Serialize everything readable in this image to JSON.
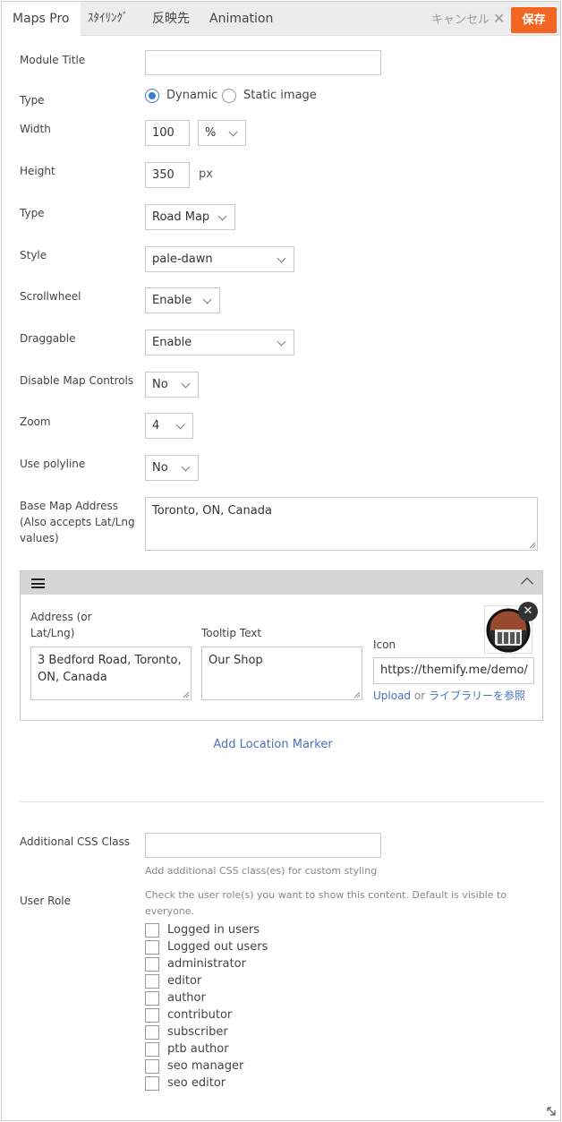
{
  "tabs": {
    "maps_pro": "Maps Pro",
    "styling": "ｽﾀｲﾘﾝｸﾞ",
    "visibility": "反映先",
    "animation": "Animation"
  },
  "header": {
    "cancel": "キャンセル",
    "save": "保存"
  },
  "fields": {
    "module_title": {
      "label": "Module Title",
      "value": ""
    },
    "type": {
      "label": "Type",
      "options": [
        "Dynamic",
        "Static image"
      ],
      "selected": "Dynamic"
    },
    "width": {
      "label": "Width",
      "value": "100",
      "unit": "%"
    },
    "height": {
      "label": "Height",
      "value": "350",
      "unit": "px"
    },
    "map_type": {
      "label": "Type",
      "value": "Road Map"
    },
    "style": {
      "label": "Style",
      "value": "pale-dawn"
    },
    "scrollwheel": {
      "label": "Scrollwheel",
      "value": "Enable"
    },
    "draggable": {
      "label": "Draggable",
      "value": "Enable"
    },
    "disable_controls": {
      "label": "Disable Map Controls",
      "value": "No"
    },
    "zoom": {
      "label": "Zoom",
      "value": "4"
    },
    "polyline": {
      "label": "Use polyline",
      "value": "No"
    },
    "base_address": {
      "label_line1": "Base Map Address",
      "label_line2": "(Also accepts Lat/Lng",
      "label_line3": "values)",
      "value": "Toronto, ON, Canada"
    }
  },
  "marker": {
    "address_label_line1": "Address (or",
    "address_label_line2": "Lat/Lng)",
    "address_line1": "3 Bedford Road, Toronto,",
    "address_line2": "ON, Canada",
    "tooltip_label": "Tooltip Text",
    "tooltip_value": "Our Shop",
    "icon_label": "Icon",
    "icon_value": "https://themify.me/demo/",
    "upload": "Upload",
    "or": "or",
    "library": "ライブラリーを参照"
  },
  "add_marker": "Add Location Marker",
  "css_class": {
    "label": "Additional CSS Class",
    "value": "",
    "hint": "Add additional CSS class(es) for custom styling"
  },
  "user_role": {
    "label": "User Role",
    "hint_line1": "Check the user role(s) you want to show this content. Default is visible to",
    "hint_line2": "everyone.",
    "roles": [
      "Logged in users",
      "Logged out users",
      "administrator",
      "editor",
      "author",
      "contributor",
      "subscriber",
      "ptb author",
      "seo manager",
      "seo editor"
    ]
  },
  "colors": {
    "accent": "#f26522",
    "link": "#4b6fbf",
    "radio": "#3c7fcf"
  }
}
